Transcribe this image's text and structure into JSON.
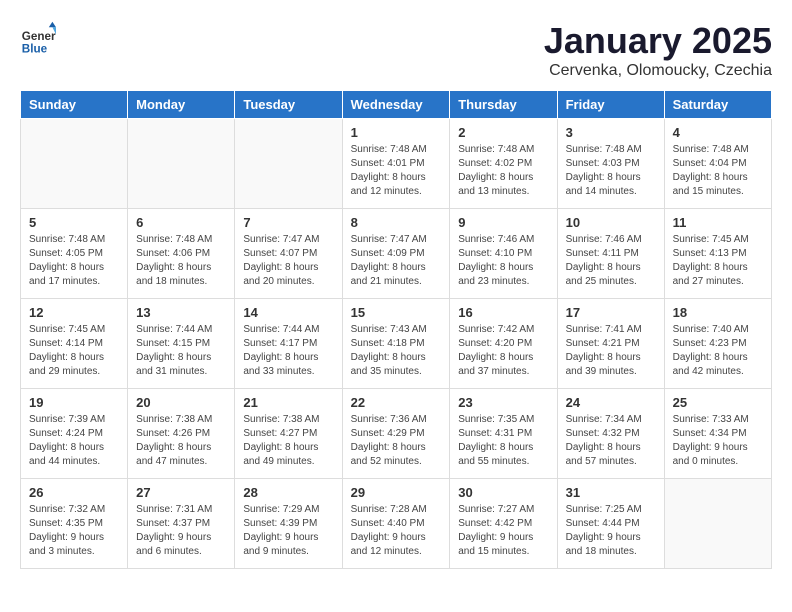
{
  "logo": {
    "general": "General",
    "blue": "Blue"
  },
  "header": {
    "month": "January 2025",
    "location": "Cervenka, Olomoucky, Czechia"
  },
  "days_of_week": [
    "Sunday",
    "Monday",
    "Tuesday",
    "Wednesday",
    "Thursday",
    "Friday",
    "Saturday"
  ],
  "weeks": [
    [
      {
        "day": "",
        "info": ""
      },
      {
        "day": "",
        "info": ""
      },
      {
        "day": "",
        "info": ""
      },
      {
        "day": "1",
        "info": "Sunrise: 7:48 AM\nSunset: 4:01 PM\nDaylight: 8 hours\nand 12 minutes."
      },
      {
        "day": "2",
        "info": "Sunrise: 7:48 AM\nSunset: 4:02 PM\nDaylight: 8 hours\nand 13 minutes."
      },
      {
        "day": "3",
        "info": "Sunrise: 7:48 AM\nSunset: 4:03 PM\nDaylight: 8 hours\nand 14 minutes."
      },
      {
        "day": "4",
        "info": "Sunrise: 7:48 AM\nSunset: 4:04 PM\nDaylight: 8 hours\nand 15 minutes."
      }
    ],
    [
      {
        "day": "5",
        "info": "Sunrise: 7:48 AM\nSunset: 4:05 PM\nDaylight: 8 hours\nand 17 minutes."
      },
      {
        "day": "6",
        "info": "Sunrise: 7:48 AM\nSunset: 4:06 PM\nDaylight: 8 hours\nand 18 minutes."
      },
      {
        "day": "7",
        "info": "Sunrise: 7:47 AM\nSunset: 4:07 PM\nDaylight: 8 hours\nand 20 minutes."
      },
      {
        "day": "8",
        "info": "Sunrise: 7:47 AM\nSunset: 4:09 PM\nDaylight: 8 hours\nand 21 minutes."
      },
      {
        "day": "9",
        "info": "Sunrise: 7:46 AM\nSunset: 4:10 PM\nDaylight: 8 hours\nand 23 minutes."
      },
      {
        "day": "10",
        "info": "Sunrise: 7:46 AM\nSunset: 4:11 PM\nDaylight: 8 hours\nand 25 minutes."
      },
      {
        "day": "11",
        "info": "Sunrise: 7:45 AM\nSunset: 4:13 PM\nDaylight: 8 hours\nand 27 minutes."
      }
    ],
    [
      {
        "day": "12",
        "info": "Sunrise: 7:45 AM\nSunset: 4:14 PM\nDaylight: 8 hours\nand 29 minutes."
      },
      {
        "day": "13",
        "info": "Sunrise: 7:44 AM\nSunset: 4:15 PM\nDaylight: 8 hours\nand 31 minutes."
      },
      {
        "day": "14",
        "info": "Sunrise: 7:44 AM\nSunset: 4:17 PM\nDaylight: 8 hours\nand 33 minutes."
      },
      {
        "day": "15",
        "info": "Sunrise: 7:43 AM\nSunset: 4:18 PM\nDaylight: 8 hours\nand 35 minutes."
      },
      {
        "day": "16",
        "info": "Sunrise: 7:42 AM\nSunset: 4:20 PM\nDaylight: 8 hours\nand 37 minutes."
      },
      {
        "day": "17",
        "info": "Sunrise: 7:41 AM\nSunset: 4:21 PM\nDaylight: 8 hours\nand 39 minutes."
      },
      {
        "day": "18",
        "info": "Sunrise: 7:40 AM\nSunset: 4:23 PM\nDaylight: 8 hours\nand 42 minutes."
      }
    ],
    [
      {
        "day": "19",
        "info": "Sunrise: 7:39 AM\nSunset: 4:24 PM\nDaylight: 8 hours\nand 44 minutes."
      },
      {
        "day": "20",
        "info": "Sunrise: 7:38 AM\nSunset: 4:26 PM\nDaylight: 8 hours\nand 47 minutes."
      },
      {
        "day": "21",
        "info": "Sunrise: 7:38 AM\nSunset: 4:27 PM\nDaylight: 8 hours\nand 49 minutes."
      },
      {
        "day": "22",
        "info": "Sunrise: 7:36 AM\nSunset: 4:29 PM\nDaylight: 8 hours\nand 52 minutes."
      },
      {
        "day": "23",
        "info": "Sunrise: 7:35 AM\nSunset: 4:31 PM\nDaylight: 8 hours\nand 55 minutes."
      },
      {
        "day": "24",
        "info": "Sunrise: 7:34 AM\nSunset: 4:32 PM\nDaylight: 8 hours\nand 57 minutes."
      },
      {
        "day": "25",
        "info": "Sunrise: 7:33 AM\nSunset: 4:34 PM\nDaylight: 9 hours\nand 0 minutes."
      }
    ],
    [
      {
        "day": "26",
        "info": "Sunrise: 7:32 AM\nSunset: 4:35 PM\nDaylight: 9 hours\nand 3 minutes."
      },
      {
        "day": "27",
        "info": "Sunrise: 7:31 AM\nSunset: 4:37 PM\nDaylight: 9 hours\nand 6 minutes."
      },
      {
        "day": "28",
        "info": "Sunrise: 7:29 AM\nSunset: 4:39 PM\nDaylight: 9 hours\nand 9 minutes."
      },
      {
        "day": "29",
        "info": "Sunrise: 7:28 AM\nSunset: 4:40 PM\nDaylight: 9 hours\nand 12 minutes."
      },
      {
        "day": "30",
        "info": "Sunrise: 7:27 AM\nSunset: 4:42 PM\nDaylight: 9 hours\nand 15 minutes."
      },
      {
        "day": "31",
        "info": "Sunrise: 7:25 AM\nSunset: 4:44 PM\nDaylight: 9 hours\nand 18 minutes."
      },
      {
        "day": "",
        "info": ""
      }
    ]
  ]
}
